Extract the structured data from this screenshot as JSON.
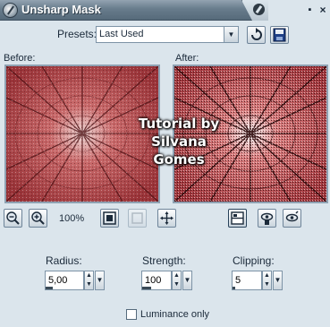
{
  "window": {
    "title": "Unsharp Mask",
    "minimize_glyph": "▪",
    "close_glyph": "×"
  },
  "presets": {
    "label": "Presets:",
    "value": "Last Used"
  },
  "preview": {
    "before_label": "Before:",
    "after_label": "After:"
  },
  "watermark": {
    "line1": "Tutorial by",
    "line2": "Silvana Gomes"
  },
  "toolbar": {
    "zoom_level": "100%"
  },
  "params": {
    "radius_label": "Radius:",
    "radius_value": "5,00",
    "strength_label": "Strength:",
    "strength_value": "100",
    "clipping_label": "Clipping:",
    "clipping_value": "5"
  },
  "luminance": {
    "label": "Luminance only",
    "checked": false
  },
  "icons": {
    "app": "gear-icon",
    "reset": "reset-arrow-icon",
    "save": "floppy-disk-icon",
    "zoom_out": "zoom-out-icon",
    "zoom_in": "zoom-in-icon",
    "zoom_fit": "zoom-fit-icon",
    "zoom_actual": "zoom-actual-icon",
    "pan": "pan-move-icon",
    "split": "split-preview-icon",
    "proof": "proof-icon",
    "auto_proof": "auto-proof-icon"
  },
  "colors": {
    "titlebar": "#687c8c",
    "panel": "#dbe5ec",
    "preview_base": "#b14a4e"
  }
}
